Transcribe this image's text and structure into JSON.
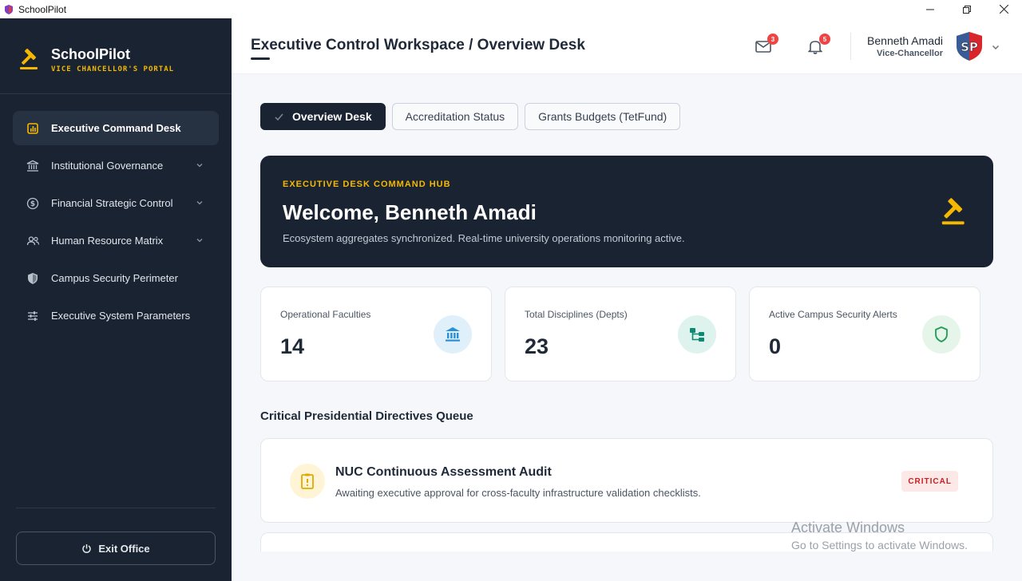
{
  "window": {
    "title": "SchoolPilot"
  },
  "brand": {
    "name": "SchoolPilot",
    "subtitle": "VICE CHANCELLOR'S PORTAL",
    "accent_color": "#f5b800"
  },
  "sidebar": {
    "items": [
      {
        "label": "Executive Command Desk",
        "icon": "chart-bar-icon",
        "active": true,
        "has_chevron": false
      },
      {
        "label": "Institutional Governance",
        "icon": "institution-icon",
        "active": false,
        "has_chevron": true
      },
      {
        "label": "Financial Strategic Control",
        "icon": "dollar-icon",
        "active": false,
        "has_chevron": true
      },
      {
        "label": "Human Resource Matrix",
        "icon": "users-icon",
        "active": false,
        "has_chevron": true
      },
      {
        "label": "Campus Security Perimeter",
        "icon": "shield-icon",
        "active": false,
        "has_chevron": false
      },
      {
        "label": "Executive System Parameters",
        "icon": "sliders-icon",
        "active": false,
        "has_chevron": false
      }
    ],
    "exit_label": "Exit Office"
  },
  "header": {
    "title": "Executive Control Workspace / Overview Desk",
    "messages_count": "3",
    "notifications_count": "5",
    "user_name": "Benneth Amadi",
    "user_role": "Vice-Chancellor",
    "avatar_initials": "SP"
  },
  "tabs": [
    {
      "label": "Overview Desk",
      "active": true
    },
    {
      "label": "Accreditation Status",
      "active": false
    },
    {
      "label": "Grants Budgets (TetFund)",
      "active": false
    }
  ],
  "hero": {
    "eyebrow": "EXECUTIVE DESK COMMAND HUB",
    "title": "Welcome, Benneth Amadi",
    "subtitle": "Ecosystem aggregates synchronized. Real-time university operations monitoring active."
  },
  "stats": [
    {
      "label": "Operational Faculties",
      "value": "14",
      "icon": "institution-icon",
      "color": "#2b8fd6",
      "bg": "#e0f0fb"
    },
    {
      "label": "Total Disciplines (Depts)",
      "value": "23",
      "icon": "hierarchy-icon",
      "color": "#0f8a72",
      "bg": "#dff3ee"
    },
    {
      "label": "Active Campus Security Alerts",
      "value": "0",
      "icon": "shield-check-icon",
      "color": "#1f9d55",
      "bg": "#e5f5ea"
    }
  ],
  "directives": {
    "section_title": "Critical Presidential Directives Queue",
    "items": [
      {
        "title": "NUC Continuous Assessment Audit",
        "description": "Awaiting executive approval for cross-faculty infrastructure validation checklists.",
        "priority": "CRITICAL",
        "icon": "alert-clipboard-icon"
      }
    ]
  },
  "watermark": {
    "line1": "Activate Windows",
    "line2": "Go to Settings to activate Windows."
  }
}
